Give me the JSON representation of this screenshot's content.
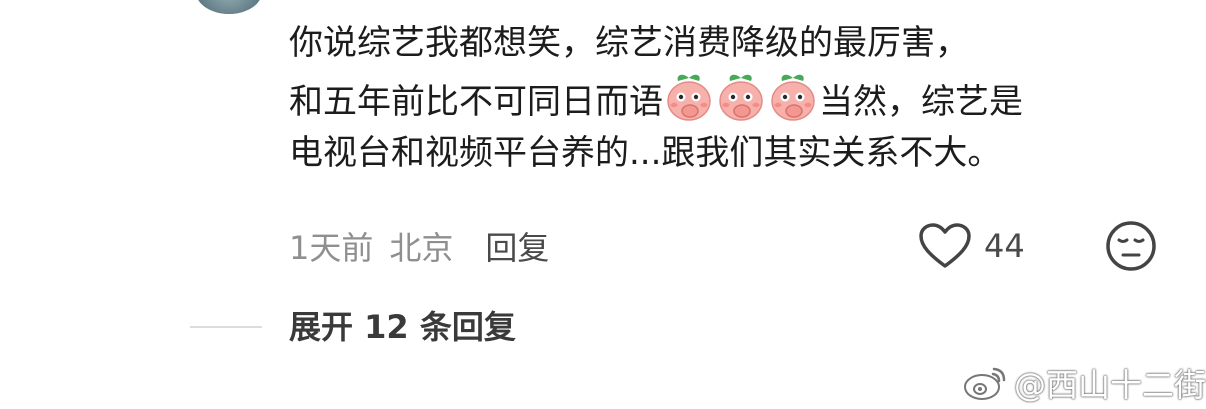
{
  "comment": {
    "line1": "你说综艺我都想笑，综艺消费降级的最厉害，",
    "line2_before": "和五年前比不可同日而语",
    "line2_after": "当然，综艺是",
    "line3": "电视台和视频平台养的...跟我们其实关系不大。",
    "emoji_name": "peach-cover-mouth-laugh-emoji",
    "emoji_count": 3
  },
  "meta": {
    "time": "1天前",
    "location": "北京",
    "reply_label": "回复"
  },
  "actions": {
    "like_count": "44",
    "like_icon": "heart-outline-icon",
    "face_icon": "neutral-face-icon"
  },
  "replies": {
    "expand_label": "展开 12 条回复"
  },
  "watermark": {
    "text": "@西山十二街",
    "icon": "weibo-logo-icon"
  },
  "colors": {
    "text": "#1c1c1c",
    "meta": "#8f8f8f",
    "emoji_peach": "#f7b1ac",
    "emoji_leaf": "#49a85a"
  }
}
